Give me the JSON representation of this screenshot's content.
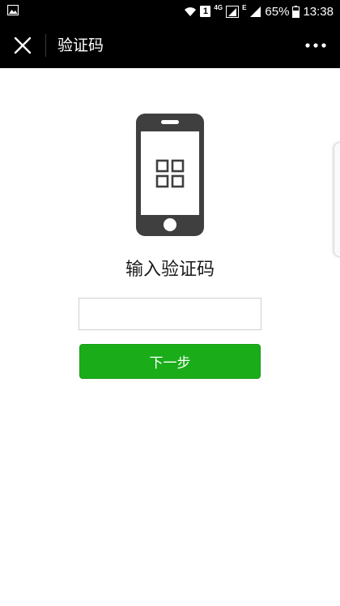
{
  "status_bar": {
    "left_icon": "gallery-icon",
    "sim_slot": "1",
    "network_4g": "4G",
    "network_e": "E",
    "battery": "65%",
    "time": "13:38",
    "icons": [
      "wifi-icon",
      "signal-icon",
      "battery-icon"
    ]
  },
  "title_bar": {
    "close_icon": "close-icon",
    "title": "验证码",
    "more_icon": "more-icon"
  },
  "content": {
    "illustration": "phone-grid-icon",
    "prompt": "输入验证码",
    "input": {
      "value": "",
      "placeholder": ""
    },
    "next_button": "下一步"
  },
  "colors": {
    "header_bg": "#000000",
    "button_green": "#1aad19",
    "phone_dark": "#3f3f3f"
  }
}
